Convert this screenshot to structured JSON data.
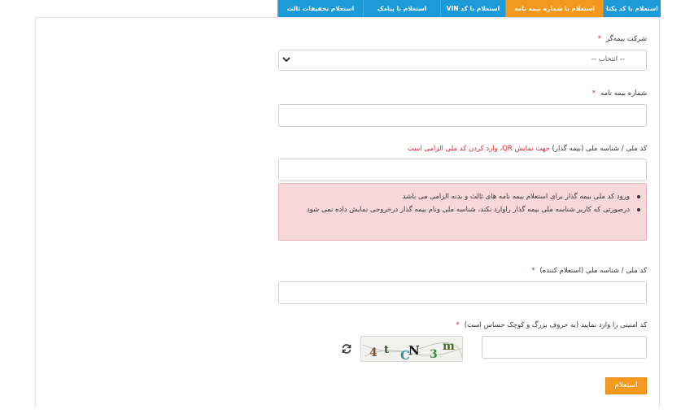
{
  "tabs": [
    {
      "label": "استعلام با کد یکتا",
      "active": false
    },
    {
      "label": "استعلام با شماره بیمه نامه",
      "active": true
    },
    {
      "label": "استعلام با کد VIN",
      "active": false
    },
    {
      "label": "استعلام با پیامک",
      "active": false
    },
    {
      "label": "استعلام تخفیفات ثالث",
      "active": false
    }
  ],
  "form": {
    "insurer_label": "شرکت بیمه‌گر",
    "insurer_placeholder": "-- انتخاب --",
    "policy_label": "شماره بیمه نامه",
    "national_id_label": "کد ملی / شناسه ملی (بیمه گذار)",
    "national_id_note": "جهت نمایش QR، وارد کردن کد ملی الزامی است",
    "alert_items": [
      "ورود کد ملی بیمه گذار برای استعلام بیمه نامه های ثالث و بدنه الزامی می باشد",
      "درصورتی که کاربر شناسه ملی بیمه گذار راوارد نکند، شناسه ملی ونام بیمه گذار درخروجی نمایش داده نمی شود"
    ],
    "inquirer_label": "کد ملی / شناسه ملی (استعلام کننده)",
    "captcha_label": "کد امنیتی را وارد نمایید (به حروف بزرگ و کوچک حساس است)",
    "required_mark": "*",
    "submit_label": "استعلام"
  },
  "captcha": {
    "chars": [
      "4",
      "t",
      "C",
      "N",
      "3",
      "m"
    ],
    "colors": [
      "#7a4b2a",
      "#2a5a2a",
      "#3a8a9a",
      "#1a1a1a",
      "#3a8a3a",
      "#4a6a2a"
    ]
  },
  "colors": {
    "tab_blue": "#1d9bd8",
    "tab_orange": "#f39a1e",
    "required_red": "#d9232d",
    "alert_bg": "#f8d7da"
  },
  "icons": {
    "select": "chevron-down-icon",
    "refresh": "refresh-icon"
  }
}
